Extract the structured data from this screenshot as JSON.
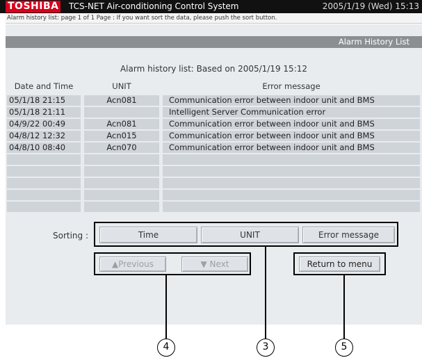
{
  "titlebar": {
    "brand": "TOSHIBA",
    "title": "TCS-NET Air-conditioning Control System",
    "datetime": "2005/1/19 (Wed)  15:13"
  },
  "infobar": {
    "text": "Alarm history list: page  1 of 1  Page : If you want sort the data, please push the sort button."
  },
  "section": {
    "title": "Alarm History List"
  },
  "list": {
    "heading": "Alarm history list: Based on 2005/1/19 15:12",
    "columns": [
      "Date and Time",
      "UNIT",
      "Error message"
    ],
    "rows": [
      [
        "05/1/18 21:15",
        "Acn081",
        "Communication error between indoor unit and BMS"
      ],
      [
        "05/1/18 21:11",
        "",
        "Intelligent Server Communication error"
      ],
      [
        "04/9/22 00:49",
        "Acn081",
        "Communication error between indoor unit and BMS"
      ],
      [
        "04/8/12 12:32",
        "Acn015",
        "Communication error between indoor unit and BMS"
      ],
      [
        "04/8/10 08:40",
        "Acn070",
        "Communication error between indoor unit and BMS"
      ],
      [
        "",
        "",
        ""
      ],
      [
        "",
        "",
        ""
      ],
      [
        "",
        "",
        ""
      ],
      [
        "",
        "",
        ""
      ],
      [
        "",
        "",
        ""
      ]
    ]
  },
  "sorting": {
    "label": "Sorting :",
    "buttons": [
      "Time",
      "UNIT",
      "Error message"
    ]
  },
  "navigation": {
    "previous": "▲Previous",
    "next": "▼ Next"
  },
  "return_button": "Return to menu",
  "callouts": {
    "nav": "4",
    "sort": "3",
    "return": "5"
  }
}
